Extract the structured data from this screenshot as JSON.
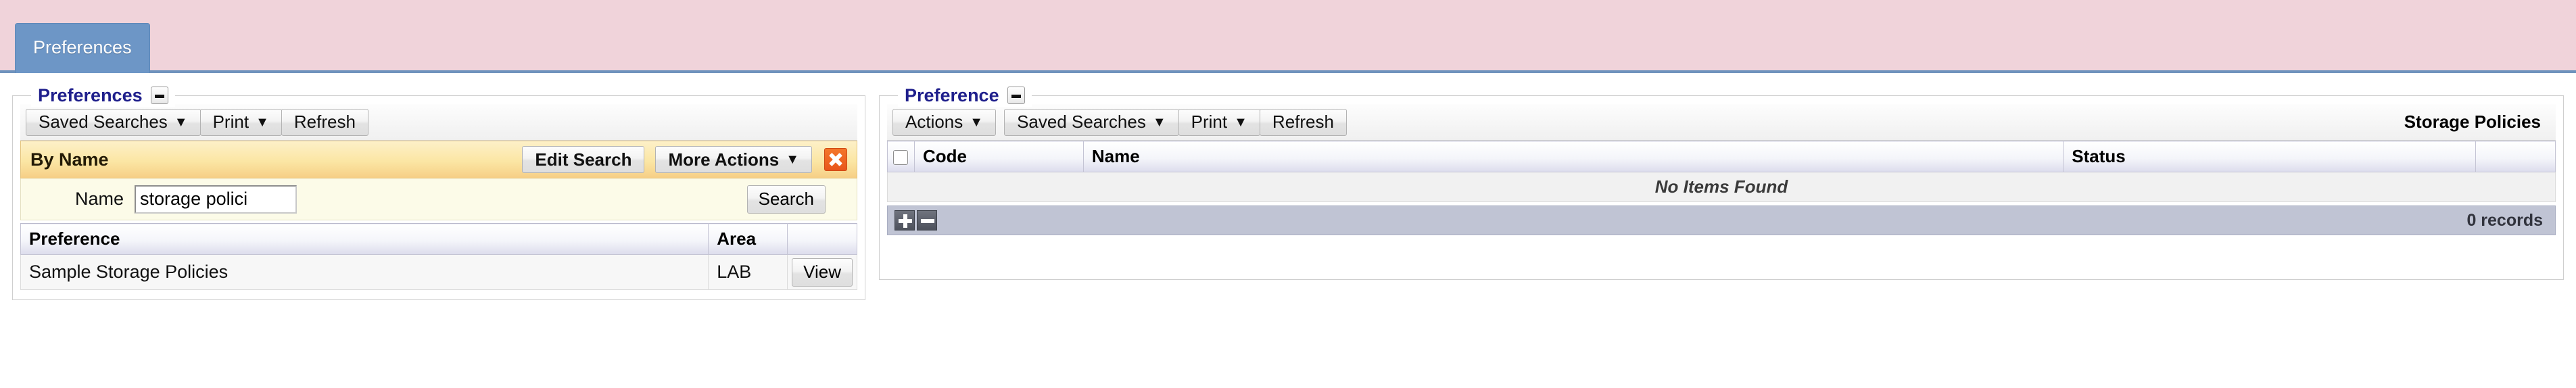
{
  "tabstrip": {
    "tabs": [
      {
        "label": "Preferences",
        "active": true
      }
    ]
  },
  "left_panel": {
    "legend": "Preferences",
    "collapse_icon": "minus-box-icon",
    "toolbar": {
      "buttons": [
        {
          "label": "Saved Searches",
          "caret": "▼"
        },
        {
          "label": "Print",
          "caret": "▼"
        },
        {
          "label": "Refresh",
          "caret": ""
        }
      ]
    },
    "criteria": {
      "title": "By Name",
      "edit_search_label": "Edit Search",
      "more_actions_label": "More Actions",
      "more_actions_caret": "▼",
      "close_icon": "close-x-icon",
      "name_label": "Name",
      "name_value": "storage polici",
      "name_placeholder": "",
      "search_label": "Search"
    },
    "results": {
      "columns": [
        "Preference",
        "Area",
        ""
      ],
      "rows": [
        {
          "preference": "Sample Storage Policies",
          "area": "LAB",
          "action": "View"
        }
      ]
    }
  },
  "right_panel": {
    "legend": "Preference",
    "collapse_icon": "minus-box-icon",
    "toolbar": {
      "buttons": [
        {
          "label": "Actions",
          "caret": "▼"
        },
        {
          "label": "Saved Searches",
          "caret": "▼"
        },
        {
          "label": "Print",
          "caret": "▼"
        },
        {
          "label": "Refresh",
          "caret": ""
        }
      ],
      "corner_label": "Storage Policies"
    },
    "grid": {
      "select_all_icon": "checkbox-unchecked-icon",
      "columns": [
        "Code",
        "Name",
        "Status",
        ""
      ],
      "rows": [],
      "empty_message": "No Items Found",
      "footer": {
        "add_icon": "plus-icon",
        "remove_icon": "minus-icon",
        "record_count": "0 records"
      }
    }
  },
  "colors": {
    "tabstrip_bg": "#f0d3da",
    "tab_active": "#6d96c6",
    "legend_text": "#1f1f8c",
    "criteria_header": "#fbe6a4",
    "criteria_body": "#fcfbe8",
    "close_button": "#e8561c",
    "grid_footer": "#c0c4d4"
  }
}
